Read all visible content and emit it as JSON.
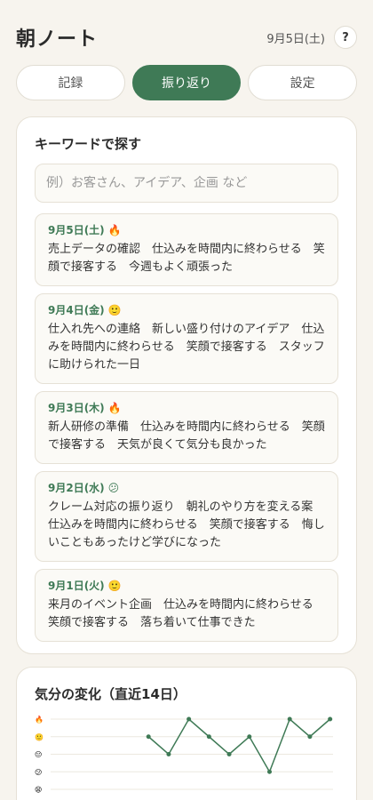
{
  "header": {
    "title": "朝ノート",
    "date": "9月5日(土)",
    "help_label": "?"
  },
  "tabs": [
    {
      "label": "記録",
      "active": false
    },
    {
      "label": "振り返り",
      "active": true
    },
    {
      "label": "設定",
      "active": false
    }
  ],
  "search": {
    "title": "キーワードで探す",
    "placeholder": "例）お客さん、アイデア、企画 など"
  },
  "entries": [
    {
      "date": "9月5日(土)",
      "mood": "🔥",
      "text": "売上データの確認　仕込みを時間内に終わらせる　笑顔で接客する　今週もよく頑張った"
    },
    {
      "date": "9月4日(金)",
      "mood": "🙂",
      "text": "仕入れ先への連絡　新しい盛り付けのアイデア　仕込みを時間内に終わらせる　笑顔で接客する　スタッフに助けられた一日"
    },
    {
      "date": "9月3日(木)",
      "mood": "🔥",
      "text": "新人研修の準備　仕込みを時間内に終わらせる　笑顔で接客する　天気が良くて気分も良かった"
    },
    {
      "date": "9月2日(水)",
      "mood": "😕",
      "text": "クレーム対応の振り返り　朝礼のやり方を変える案　仕込みを時間内に終わらせる　笑顔で接客する　悔しいこともあったけど学びになった"
    },
    {
      "date": "9月1日(火)",
      "mood": "🙂",
      "text": "来月のイベント企画　仕込みを時間内に終わらせる　笑顔で接客する　落ち着いて仕事できた"
    }
  ],
  "mood_chart": {
    "title": "気分の変化（直近14日）",
    "levels": [
      "🔥",
      "🙂",
      "😐",
      "😕",
      "😫"
    ],
    "line_color": "#3f7a56",
    "chart_data": {
      "type": "line",
      "x": [
        1,
        2,
        3,
        4,
        5,
        6,
        7,
        8,
        9,
        10,
        11,
        12,
        13,
        14
      ],
      "values": [
        null,
        null,
        null,
        null,
        4,
        3,
        5,
        4,
        3,
        4,
        2,
        5,
        4,
        5
      ],
      "ylim": [
        1,
        5
      ],
      "grid": true
    }
  }
}
